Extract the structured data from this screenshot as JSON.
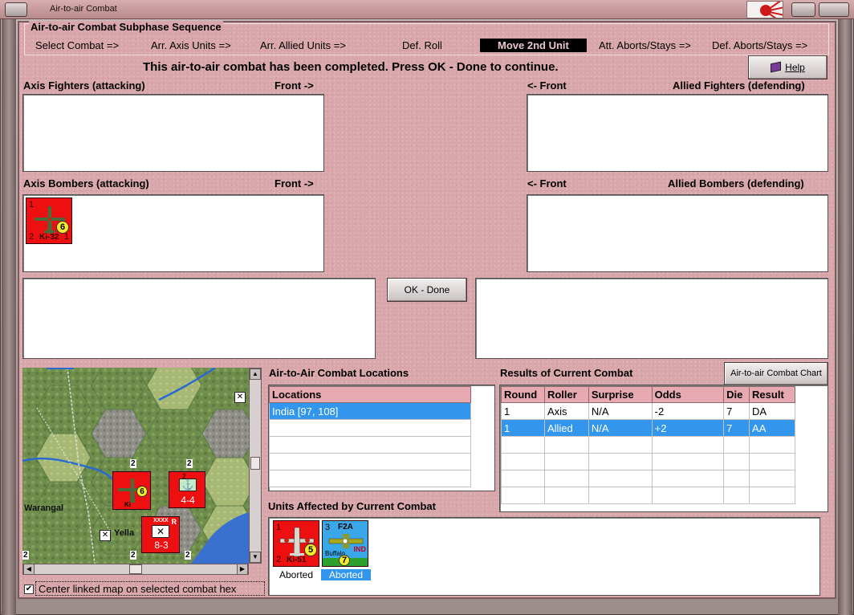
{
  "window": {
    "title": "Air-to-air Combat"
  },
  "sequence": {
    "title": "Air-to-air Combat Subphase Sequence",
    "steps": [
      "Select Combat =>",
      "Arr. Axis Units =>",
      "Arr. Allied Units  =>",
      "Def. Roll",
      "Move 2nd Unit",
      "Att. Aborts/Stays =>",
      "Def. Aborts/Stays =>"
    ],
    "active_step": "Move 2nd Unit"
  },
  "message": "This air-to-air combat has been completed.  Press OK - Done to continue.",
  "help_button": "Help",
  "axis_fighters": {
    "label": "Axis Fighters (attacking)",
    "front": "Front ->"
  },
  "allied_fighters": {
    "label": "Allied Fighters (defending)",
    "front": "<- Front"
  },
  "axis_bombers": {
    "label": "Axis Bombers (attacking)",
    "front": "Front ->",
    "units": [
      {
        "top_left": "1",
        "bottom_left": "2",
        "name": "Ki-32",
        "bottom_right": "1",
        "dot": "6",
        "color": "#ee1010"
      }
    ]
  },
  "allied_bombers": {
    "label": "Allied Bombers (defending)",
    "front": "<- Front"
  },
  "ok_button": "OK - Done",
  "locations": {
    "title": "Air-to-Air Combat Locations",
    "header": "Locations",
    "rows": [
      "India [97, 108]",
      "",
      "",
      "",
      "",
      ""
    ]
  },
  "results": {
    "title": "Results of Current Combat",
    "chart_button": "Air-to-air Combat Chart",
    "columns": [
      "Round",
      "Roller",
      "Surprise",
      "Odds",
      "Die",
      "Result"
    ],
    "rows": [
      [
        "1",
        "Axis",
        "N/A",
        "-2",
        "7",
        "DA"
      ],
      [
        "1",
        "Allied",
        "N/A",
        "+2",
        "7",
        "AA"
      ],
      [
        "",
        "",
        "",
        "",
        "",
        ""
      ],
      [
        "",
        "",
        "",
        "",
        "",
        ""
      ],
      [
        "",
        "",
        "",
        "",
        "",
        ""
      ],
      [
        "",
        "",
        "",
        "",
        "",
        ""
      ]
    ],
    "selected_row": 1
  },
  "affected": {
    "title": "Units Affected by Current Combat",
    "units": [
      {
        "top_left": "1",
        "bottom_left": "2",
        "name": "Ki-51",
        "dot": "5",
        "status": "Aborted",
        "color": "#ee1010"
      },
      {
        "top_left": "3",
        "name": "F2A",
        "subname": "Buffalo",
        "nation": "IND",
        "dot": "7",
        "status": "Aborted",
        "color": "#3aa8e8"
      }
    ]
  },
  "map": {
    "labels": [
      "Warangal",
      "Yella"
    ],
    "counters": [
      {
        "value": "6",
        "name": "Ki"
      },
      {
        "value": "4-4",
        "top": "2"
      },
      {
        "value": "8-3",
        "top": "XXXX",
        "mark": "R"
      }
    ],
    "hex_numbers": [
      "2",
      "2",
      "2",
      "2",
      "2"
    ]
  },
  "center_map": {
    "label": "Center linked map on selected combat hex",
    "checked": true,
    "check_mark": "✔"
  },
  "colors": {
    "panel": "#d9a7ab",
    "header": "#e7aab2",
    "selection": "#3296ec",
    "axis_counter": "#ee1010",
    "allied_counter": "#3aa8e8"
  }
}
